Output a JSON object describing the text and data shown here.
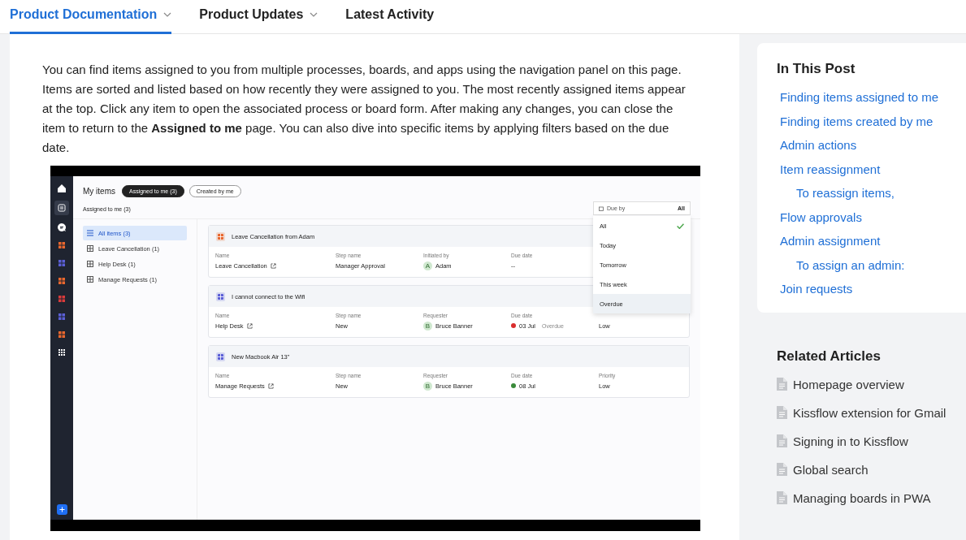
{
  "nav": {
    "tabs": [
      {
        "label": "Product Documentation",
        "selected": true,
        "dropdown": true
      },
      {
        "label": "Product Updates",
        "selected": false,
        "dropdown": true
      },
      {
        "label": "Latest Activity",
        "selected": false,
        "dropdown": false
      }
    ]
  },
  "article": {
    "paragraph": "You can find items assigned to you from multiple processes, boards, and apps using the navigation panel on this page. Items are sorted and listed based on how recently they were assigned to you. The most recently assigned items appear at the top. Click any item to open the associated process or board form. After making any changes, you can close the item to return to the **Assigned to me** page. You can also dive into specific items by applying filters based on the due date.",
    "screenshot": {
      "rail_apps": [
        {
          "color": "#e8672e"
        },
        {
          "color": "#5b5fd6"
        },
        {
          "color": "#e8672e"
        },
        {
          "color": "#d93b3b"
        },
        {
          "color": "#5b5fd6"
        },
        {
          "color": "#e8672e"
        }
      ],
      "title": "My items",
      "tabs": [
        {
          "label": "Assigned to me (3)",
          "selected": true
        },
        {
          "label": "Created by me",
          "selected": false
        }
      ],
      "subtitle": "Assigned to me (3)",
      "lists": [
        {
          "label": "All items (3)",
          "selected": true
        },
        {
          "label": "Leave Cancellation (1)",
          "selected": false
        },
        {
          "label": "Help Desk (1)",
          "selected": false
        },
        {
          "label": "Manage Requests (1)",
          "selected": false
        }
      ],
      "cards": [
        {
          "title": "Leave Cancellation from Adam",
          "color": "#e8672e",
          "fields": [
            {
              "kind": "link",
              "label": "Name",
              "value": "Leave Cancellation"
            },
            {
              "kind": "text",
              "label": "Step name",
              "value": "Manager Approval"
            },
            {
              "kind": "person",
              "label": "Initiated by",
              "initial": "A",
              "value": "Adam"
            },
            {
              "kind": "text",
              "label": "Due date",
              "value": "--"
            }
          ]
        },
        {
          "title": "I cannot connect to the Wifi",
          "color": "#5b5fd6",
          "fields": [
            {
              "kind": "link",
              "label": "Name",
              "value": "Help Desk"
            },
            {
              "kind": "text",
              "label": "Step name",
              "value": "New"
            },
            {
              "kind": "person",
              "label": "Requester",
              "initial": "B",
              "value": "Bruce Banner"
            },
            {
              "kind": "date",
              "label": "Due date",
              "value": "03 Jul",
              "color": "#d92d2d",
              "tag": "Overdue"
            },
            {
              "kind": "text",
              "value": "Low"
            }
          ]
        },
        {
          "title": "New Macbook Air 13\"",
          "color": "#5b5fd6",
          "fields": [
            {
              "kind": "link",
              "label": "Name",
              "value": "Manage Requests"
            },
            {
              "kind": "text",
              "label": "Step name",
              "value": "New"
            },
            {
              "kind": "person",
              "label": "Requester",
              "initial": "B",
              "value": "Bruce Banner"
            },
            {
              "kind": "date",
              "label": "Due date",
              "value": "08 Jul",
              "color": "#3a8a3a"
            },
            {
              "kind": "text",
              "label": "Priority",
              "value": "Low"
            }
          ]
        }
      ],
      "filter": {
        "label": "Due by",
        "value": "All",
        "options": [
          {
            "label": "All",
            "selected": true,
            "hovered": false
          },
          {
            "label": "Today",
            "selected": false,
            "hovered": false
          },
          {
            "label": "Tomorrow",
            "selected": false,
            "hovered": false
          },
          {
            "label": "This week",
            "selected": false,
            "hovered": false
          },
          {
            "label": "Overdue",
            "selected": false,
            "hovered": true
          }
        ]
      }
    }
  },
  "toc": {
    "title": "In This Post",
    "items": [
      {
        "label": "Finding items assigned to me"
      },
      {
        "label": "Finding items created by me"
      },
      {
        "label": "Admin actions"
      },
      {
        "label": "Item reassignment",
        "children": [
          {
            "label": "To reassign items,"
          }
        ]
      },
      {
        "label": "Flow approvals"
      },
      {
        "label": "Admin assignment",
        "children": [
          {
            "label": "To assign an admin:"
          }
        ]
      },
      {
        "label": "Join requests"
      }
    ]
  },
  "related": {
    "title": "Related Articles",
    "items": [
      "Homepage overview",
      "Kissflow extension for Gmail",
      "Signing in to Kissflow",
      "Global search",
      "Managing boards in PWA"
    ]
  }
}
